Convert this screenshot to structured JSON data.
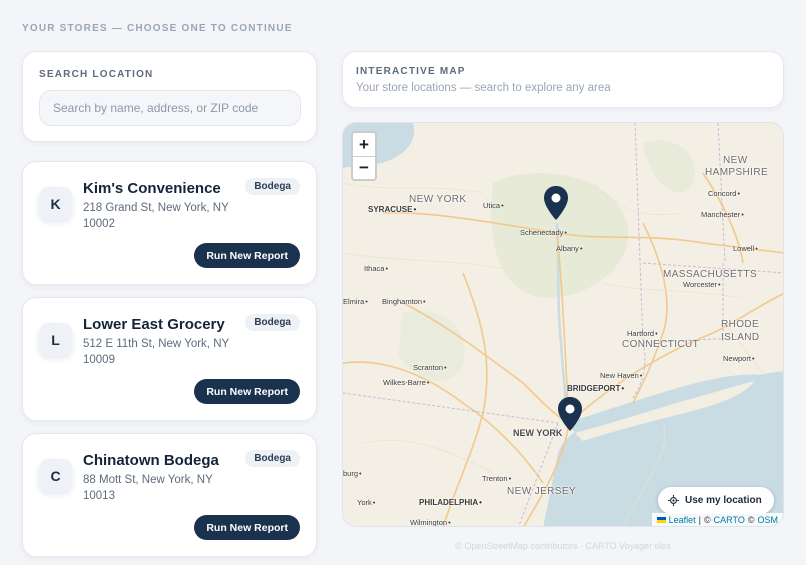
{
  "page": {
    "heading": "YOUR STORES — CHOOSE ONE TO CONTINUE"
  },
  "search": {
    "label": "SEARCH LOCATION",
    "placeholder": "Search by name, address, or ZIP code",
    "value": ""
  },
  "stores": [
    {
      "initial": "K",
      "name": "Kim's Convenience",
      "address": "218 Grand St, New York, NY 10002",
      "badge": "Bodega",
      "action": "Run New Report"
    },
    {
      "initial": "L",
      "name": "Lower East Grocery",
      "address": "512 E 11th St, New York, NY 10009",
      "badge": "Bodega",
      "action": "Run New Report"
    },
    {
      "initial": "C",
      "name": "Chinatown Bodega",
      "address": "88 Mott St, New York, NY 10013",
      "badge": "Bodega",
      "action": "Run New Report"
    }
  ],
  "map": {
    "title": "INTERACTIVE MAP",
    "subtitle": "Your store locations — search to explore any area",
    "zoom_in": "+",
    "zoom_out": "−",
    "locate_label": "Use my location",
    "attribution": {
      "leaflet": "Leaflet",
      "sep1": "|",
      "copy": "©",
      "carto": "CARTO",
      "copy2": "©",
      "osm": "OSM"
    },
    "labels": {
      "new_york_state": "NEW YORK",
      "syracuse": "SYRACUSE",
      "utica": "Utica",
      "schenectady": "Schenectady",
      "albany": "Albany",
      "ithaca": "Ithaca",
      "elmira": "Elmira",
      "binghamton": "Binghamton",
      "scranton": "Scranton",
      "wilkes_barre": "Wilkes-Barre",
      "new_hampshire_1": "NEW",
      "new_hampshire_2": "HAMPSHIRE",
      "concord": "Concord",
      "manchester": "Manchester",
      "lowell": "Lowell",
      "massachusetts": "MASSACHUSETTS",
      "worcester": "Worcester",
      "hartford": "Hartford",
      "connecticut": "CONNECTICUT",
      "rhode_island_1": "RHODE",
      "rhode_island_2": "ISLAND",
      "newport": "Newport",
      "new_haven": "New Haven",
      "bridgeport": "BRIDGEPORT",
      "new_york_city": "NEW YORK",
      "trenton": "Trenton",
      "new_jersey": "NEW JERSEY",
      "philadelphia": "PHILADELPHIA",
      "york": "York",
      "burg": "burg",
      "wilmington": "Wilmington"
    },
    "pin_color": "#1b324f"
  },
  "footer": {
    "note": "© OpenStreetMap contributors · CARTO Voyager tiles"
  }
}
